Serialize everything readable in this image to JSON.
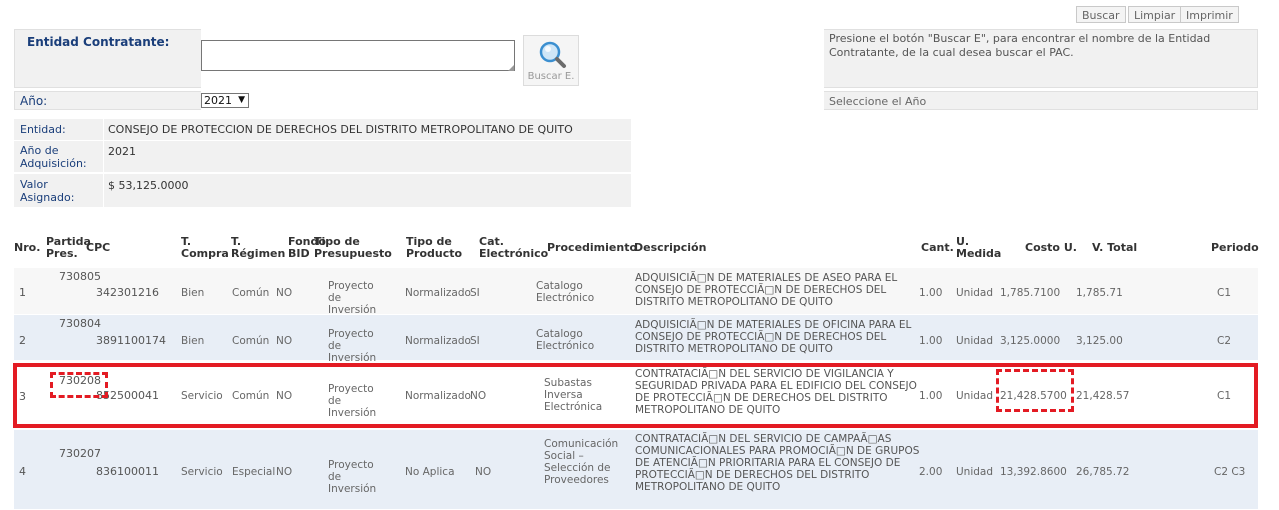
{
  "toolbar": {
    "buscar": "Buscar",
    "limpiar": "Limpiar",
    "imprimir": "Imprimir"
  },
  "search": {
    "entidad_label": "Entidad Contratante:",
    "entidad_value": "",
    "search_button_label": "Buscar E.",
    "hint": "Presione el botón \"Buscar E\", para encontrar el nombre de la Entidad Contratante, de la cual desea buscar el PAC.",
    "anio_label": "Año:",
    "anio_value": "2021",
    "anio_hint": "Seleccione el Año"
  },
  "info": {
    "entidad_label": "Entidad:",
    "entidad_value": "CONSEJO DE PROTECCION DE DERECHOS DEL DISTRITO METROPOLITANO DE QUITO",
    "anio_label": "Año de Adquisición:",
    "anio_value": "2021",
    "valor_label": "Valor Asignado:",
    "valor_value": "$ 53,125.0000"
  },
  "table": {
    "headers": {
      "nro": "Nro.",
      "partida": "Partida Pres.",
      "cpc": "CPC",
      "tcompra": "T. Compra",
      "tregimen": "T. Régimen",
      "fondo": "Fondo BID",
      "tipo_presupuesto": "Tipo de Presupuesto",
      "tipo_producto": "Tipo de Producto",
      "cat": "Cat. Electrónico",
      "procedimiento": "Procedimiento",
      "descripcion": "Descripción",
      "cant": "Cant.",
      "umedida": "U. Medida",
      "costo": "Costo U.",
      "vtotal": "V. Total",
      "periodo": "Periodo"
    },
    "rows": [
      {
        "nro": "1",
        "partida": "730805",
        "cpc": "342301216",
        "tcompra": "Bien",
        "tregimen": "Común",
        "fondo": "NO",
        "tipo_presupuesto": "Proyecto de Inversión",
        "tipo_producto": "Normalizado",
        "cat": "SI",
        "procedimiento": "Catalogo Electrónico",
        "descripcion": "ADQUISICIÃ□N DE MATERIALES DE ASEO PARA EL CONSEJO DE PROTECCIÃ□N DE DERECHOS DEL DISTRITO METROPOLITANO DE QUITO",
        "cant": "1.00",
        "umedida": "Unidad",
        "costo": "1,785.7100",
        "vtotal": "1,785.71",
        "periodo": "C1"
      },
      {
        "nro": "2",
        "partida": "730804",
        "cpc": "3891100174",
        "tcompra": "Bien",
        "tregimen": "Común",
        "fondo": "NO",
        "tipo_presupuesto": "Proyecto de Inversión",
        "tipo_producto": "Normalizado",
        "cat": "SI",
        "procedimiento": "Catalogo Electrónico",
        "descripcion": "ADQUISICIÃ□N DE MATERIALES DE OFICINA PARA EL CONSEJO DE PROTECCIÃ□N DE DERECHOS DEL DISTRITO METROPOLITANO DE QUITO",
        "cant": "1.00",
        "umedida": "Unidad",
        "costo": "3,125.0000",
        "vtotal": "3,125.00",
        "periodo": "C2"
      },
      {
        "nro": "3",
        "partida": "730208",
        "cpc": "852500041",
        "tcompra": "Servicio",
        "tregimen": "Común",
        "fondo": "NO",
        "tipo_presupuesto": "Proyecto de Inversión",
        "tipo_producto": "Normalizado",
        "cat": "NO",
        "procedimiento": "Subastas Inversa Electrónica",
        "descripcion": "CONTRATACIÃ□N DEL SERVICIO DE VIGILANCIA Y SEGURIDAD PRIVADA PARA EL EDIFICIO DEL CONSEJO DE PROTECCIÃ□N DE DERECHOS DEL DISTRITO METROPOLITANO DE QUITO",
        "cant": "1.00",
        "umedida": "Unidad",
        "costo": "21,428.5700",
        "vtotal": "21,428.57",
        "periodo": "C1"
      },
      {
        "nro": "4",
        "partida": "730207",
        "cpc": "836100011",
        "tcompra": "Servicio",
        "tregimen": "Especial",
        "fondo": "NO",
        "tipo_presupuesto": "Proyecto de Inversión",
        "tipo_producto": "No Aplica",
        "cat": "NO",
        "procedimiento": "Comunicación Social – Selección de Proveedores",
        "descripcion": "CONTRATACIÃ□N DEL SERVICIO DE CAMPAÃ□AS COMUNICACIONALES PARA PROMOCIÃ□N DE GRUPOS DE ATENCIÃ□N PRIORITARIA PARA EL CONSEJO DE PROTECCIÃ□N DE DERECHOS DEL DISTRITO METROPOLITANO DE QUITO",
        "cant": "2.00",
        "umedida": "Unidad",
        "costo": "13,392.8600",
        "vtotal": "26,785.72",
        "periodo": "C2 C3"
      }
    ]
  },
  "highlight_color": "#e31b23"
}
